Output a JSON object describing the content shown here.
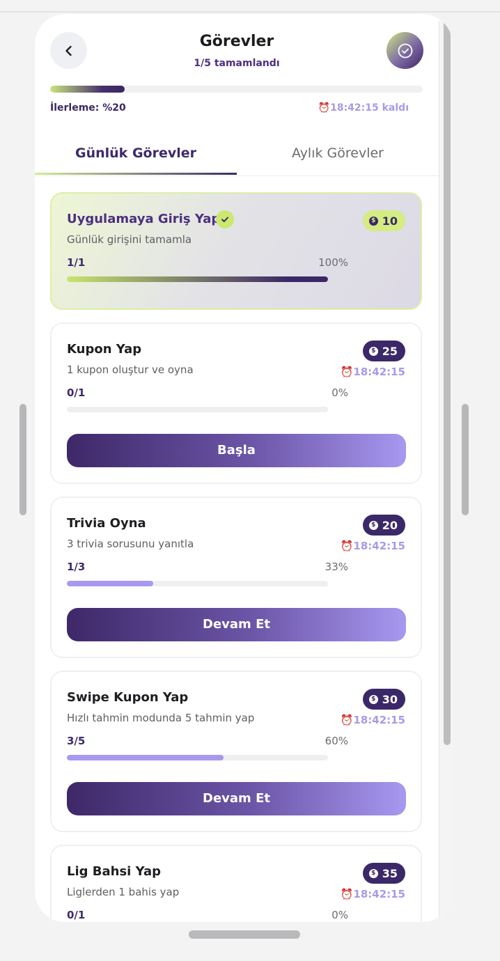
{
  "header": {
    "title": "Görevler",
    "subtitle": "1/5 tamamlandı",
    "progress_label": "İlerleme: %20",
    "progress_value": 0.2,
    "time_left": "⏰18:42:15 kaldı"
  },
  "tabs": [
    {
      "label": "Günlük Görevler",
      "active": true
    },
    {
      "label": "Aylık Görevler",
      "active": false
    }
  ],
  "tasks": [
    {
      "title": "Uygulamaya Giriş Yap",
      "desc": "Günlük girişini tamamla",
      "count": "1/1",
      "pct": "100%",
      "progress": 1.0,
      "reward": "10",
      "completed": true
    },
    {
      "title": "Kupon Yap",
      "desc": "1 kupon oluştur ve oyna",
      "count": "0/1",
      "pct": "0%",
      "progress": 0.0,
      "reward": "25",
      "timer": "⏰18:42:15",
      "button": "Başla"
    },
    {
      "title": "Trivia Oyna",
      "desc": "3 trivia sorusunu yanıtla",
      "count": "1/3",
      "pct": "33%",
      "progress": 0.33,
      "reward": "20",
      "timer": "⏰18:42:15",
      "button": "Devam Et"
    },
    {
      "title": "Swipe Kupon Yap",
      "desc": "Hızlı tahmin modunda 5 tahmin yap",
      "count": "3/5",
      "pct": "60%",
      "progress": 0.6,
      "reward": "30",
      "timer": "⏰18:42:15",
      "button": "Devam Et"
    },
    {
      "title": "Lig Bahsi Yap",
      "desc": "Liglerden 1 bahis yap",
      "count": "0/1",
      "pct": "0%",
      "progress": 0.0,
      "reward": "35",
      "timer": "⏰18:42:15"
    }
  ],
  "colors": {
    "accent": "#3b2868",
    "lime": "#cbe86f",
    "lavender": "#a998f0"
  }
}
